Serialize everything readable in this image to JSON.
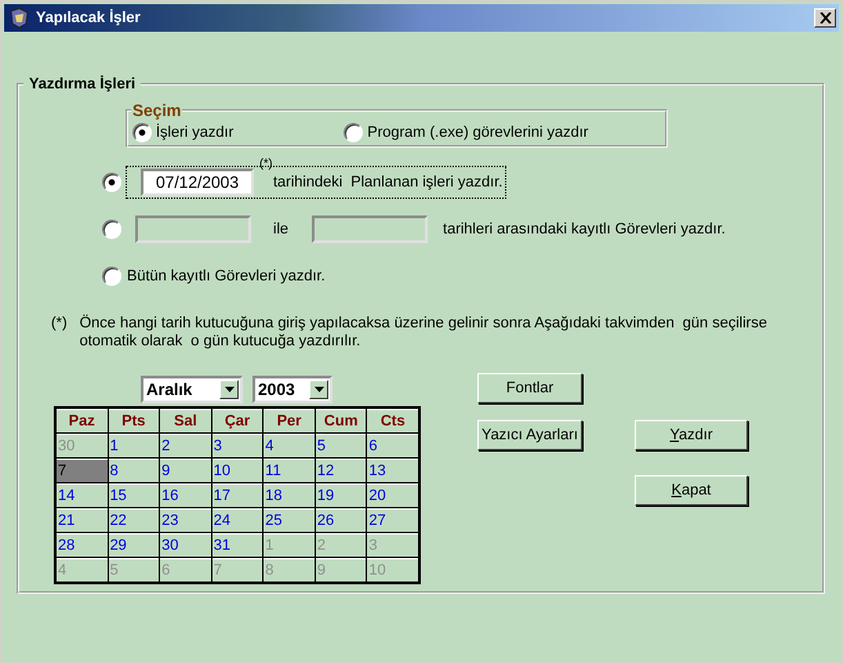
{
  "window": {
    "title": "Yapılacak İşler"
  },
  "print_group": {
    "legend": "Yazdırma İşleri",
    "selection": {
      "legend": "Seçim",
      "options": [
        {
          "label": "İşleri yazdır",
          "selected": true
        },
        {
          "label": "Program (.exe) görevlerini yazdır",
          "selected": false
        }
      ]
    },
    "date_options": [
      {
        "kind": "single",
        "selected": true,
        "focused": true,
        "value": "07/12/2003",
        "footnote": "(*)",
        "label": "tarihindeki  Planlanan işleri yazdır."
      },
      {
        "kind": "range",
        "selected": false,
        "joiner": "ile",
        "label": "tarihleri arasındaki kayıtlı Görevleri yazdır."
      },
      {
        "kind": "all",
        "selected": false,
        "label": "Bütün kayıtlı Görevleri yazdır."
      }
    ],
    "note": {
      "mark": "(*)",
      "lines": [
        "Önce hangi tarih kutucuğuna giriş yapılacaksa üzerine gelinir sonra Aşağıdaki takvimden  gün seçilirse",
        "otomatik olarak  o gün kutucuğa yazdırılır."
      ]
    },
    "calendar": {
      "month": "Aralık",
      "year": "2003",
      "weekdays": [
        "Paz",
        "Pts",
        "Sal",
        "Çar",
        "Per",
        "Cum",
        "Cts"
      ],
      "weeks": [
        [
          {
            "day": "30",
            "in_month": false,
            "selected": false
          },
          {
            "day": "1",
            "in_month": true,
            "selected": false
          },
          {
            "day": "2",
            "in_month": true,
            "selected": false
          },
          {
            "day": "3",
            "in_month": true,
            "selected": false
          },
          {
            "day": "4",
            "in_month": true,
            "selected": false
          },
          {
            "day": "5",
            "in_month": true,
            "selected": false
          },
          {
            "day": "6",
            "in_month": true,
            "selected": false
          }
        ],
        [
          {
            "day": "7",
            "in_month": true,
            "selected": true
          },
          {
            "day": "8",
            "in_month": true,
            "selected": false
          },
          {
            "day": "9",
            "in_month": true,
            "selected": false
          },
          {
            "day": "10",
            "in_month": true,
            "selected": false
          },
          {
            "day": "11",
            "in_month": true,
            "selected": false
          },
          {
            "day": "12",
            "in_month": true,
            "selected": false
          },
          {
            "day": "13",
            "in_month": true,
            "selected": false
          }
        ],
        [
          {
            "day": "14",
            "in_month": true,
            "selected": false
          },
          {
            "day": "15",
            "in_month": true,
            "selected": false
          },
          {
            "day": "16",
            "in_month": true,
            "selected": false
          },
          {
            "day": "17",
            "in_month": true,
            "selected": false
          },
          {
            "day": "18",
            "in_month": true,
            "selected": false
          },
          {
            "day": "19",
            "in_month": true,
            "selected": false
          },
          {
            "day": "20",
            "in_month": true,
            "selected": false
          }
        ],
        [
          {
            "day": "21",
            "in_month": true,
            "selected": false
          },
          {
            "day": "22",
            "in_month": true,
            "selected": false
          },
          {
            "day": "23",
            "in_month": true,
            "selected": false
          },
          {
            "day": "24",
            "in_month": true,
            "selected": false
          },
          {
            "day": "25",
            "in_month": true,
            "selected": false
          },
          {
            "day": "26",
            "in_month": true,
            "selected": false
          },
          {
            "day": "27",
            "in_month": true,
            "selected": false
          }
        ],
        [
          {
            "day": "28",
            "in_month": true,
            "selected": false
          },
          {
            "day": "29",
            "in_month": true,
            "selected": false
          },
          {
            "day": "30",
            "in_month": true,
            "selected": false
          },
          {
            "day": "31",
            "in_month": true,
            "selected": false
          },
          {
            "day": "1",
            "in_month": false,
            "selected": false
          },
          {
            "day": "2",
            "in_month": false,
            "selected": false
          },
          {
            "day": "3",
            "in_month": false,
            "selected": false
          }
        ],
        [
          {
            "day": "4",
            "in_month": false,
            "selected": false
          },
          {
            "day": "5",
            "in_month": false,
            "selected": false
          },
          {
            "day": "6",
            "in_month": false,
            "selected": false
          },
          {
            "day": "7",
            "in_month": false,
            "selected": false
          },
          {
            "day": "8",
            "in_month": false,
            "selected": false
          },
          {
            "day": "9",
            "in_month": false,
            "selected": false
          },
          {
            "day": "10",
            "in_month": false,
            "selected": false
          }
        ]
      ]
    },
    "buttons": [
      {
        "label": "Fontlar",
        "accelerator": false
      },
      {
        "label": "Yazıcı Ayarları",
        "accelerator": false
      },
      {
        "label": "Yazdır",
        "accelerator": true
      },
      {
        "label": "Kapat",
        "accelerator": true
      }
    ]
  }
}
